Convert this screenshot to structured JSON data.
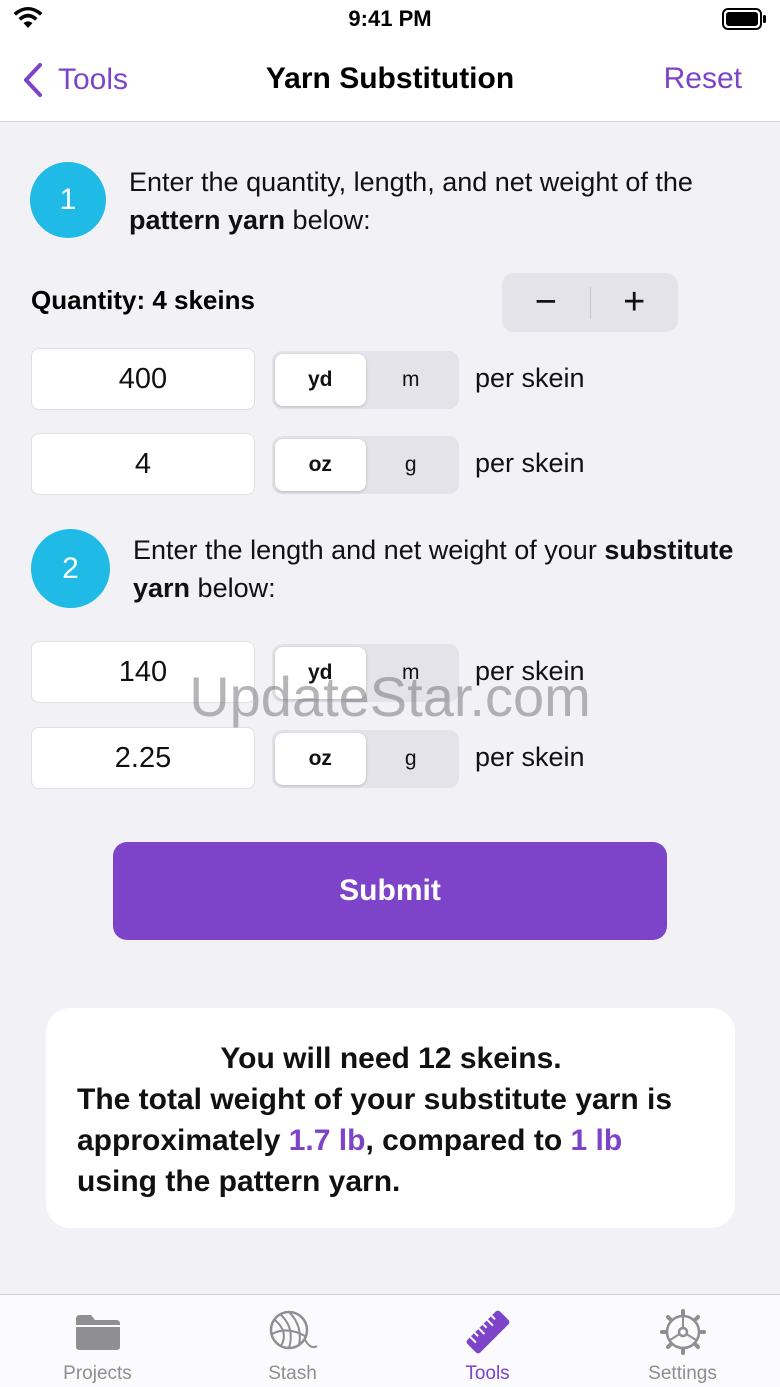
{
  "status_bar": {
    "time": "9:41 PM"
  },
  "nav": {
    "back_label": "Tools",
    "title": "Yarn Substitution",
    "reset_label": "Reset"
  },
  "step1": {
    "number": "1",
    "text_before": "Enter the quantity, length, and net weight of the ",
    "text_bold": "pattern yarn",
    "text_after": " below:"
  },
  "quantity": {
    "label": "Quantity: 4 skeins",
    "minus": "−",
    "plus": "+"
  },
  "pattern_length": {
    "value": "400",
    "units": [
      "yd",
      "m"
    ],
    "selected_unit": "yd",
    "per": "per skein"
  },
  "pattern_weight": {
    "value": "4",
    "units": [
      "oz",
      "g"
    ],
    "selected_unit": "oz",
    "per": "per skein"
  },
  "step2": {
    "number": "2",
    "text_before": "Enter the length and net weight of your ",
    "text_bold": "substitute yarn",
    "text_after": " below:"
  },
  "sub_length": {
    "value": "140",
    "units": [
      "yd",
      "m"
    ],
    "selected_unit": "yd",
    "per": "per skein"
  },
  "sub_weight": {
    "value": "2.25",
    "units": [
      "oz",
      "g"
    ],
    "selected_unit": "oz",
    "per": "per skein"
  },
  "submit_label": "Submit",
  "result": {
    "line1": "You will need 12 skeins.",
    "line2_a": "The total weight of your substitute yarn is approximately ",
    "sub_weight": "1.7 lb",
    "line2_b": ", compared to ",
    "pattern_weight": "1 lb",
    "line2_c": " using the pattern yarn."
  },
  "watermark": "UpdateStar.com",
  "tabs": [
    {
      "label": "Projects",
      "icon": "folder-icon"
    },
    {
      "label": "Stash",
      "icon": "yarn-ball-icon"
    },
    {
      "label": "Tools",
      "icon": "ruler-icon"
    },
    {
      "label": "Settings",
      "icon": "gear-icon"
    }
  ],
  "colors": {
    "accent": "#7d43c8",
    "step_circle": "#1fbbe6",
    "background": "#f2f1f6"
  }
}
